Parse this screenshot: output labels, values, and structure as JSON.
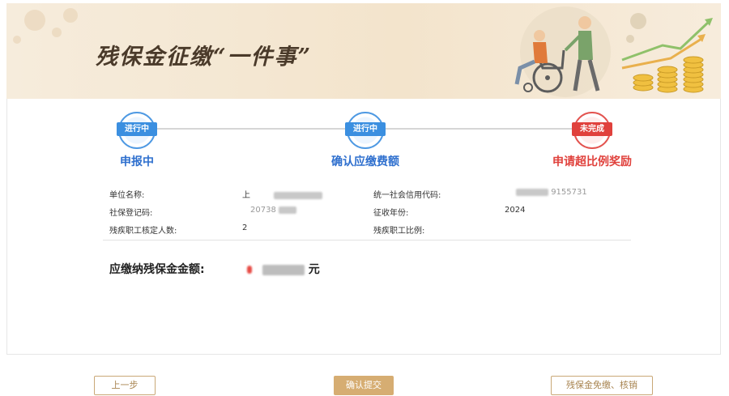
{
  "banner": {
    "title": "残保金征缴“一件事”"
  },
  "steps": [
    {
      "badge": "进行中",
      "label": "申报中",
      "status": "in-progress",
      "color": "#3b8fe0"
    },
    {
      "badge": "进行中",
      "label": "确认应缴费额",
      "status": "in-progress",
      "color": "#3b8fe0"
    },
    {
      "badge": "未完成",
      "label": "申请超比例奖励",
      "status": "incomplete",
      "color": "#e0413c"
    }
  ],
  "info": {
    "unit_name_label": "单位名称:",
    "unit_name_value": "上",
    "credit_code_label": "统一社会信用代码:",
    "credit_code_value": "9155731",
    "social_reg_label": "社保登记码:",
    "social_reg_value": "20738",
    "levy_year_label": "征收年份:",
    "levy_year_value": "2024",
    "disabled_count_label": "残疾职工核定人数:",
    "disabled_count_value": "2",
    "disabled_ratio_label": "残疾职工比例:",
    "disabled_ratio_value": ""
  },
  "amount": {
    "label": "应缴纳残保金金额:",
    "unit": "元"
  },
  "buttons": {
    "prev": "上一步",
    "confirm": "确认提交",
    "exempt": "残保金免缴、核销"
  }
}
